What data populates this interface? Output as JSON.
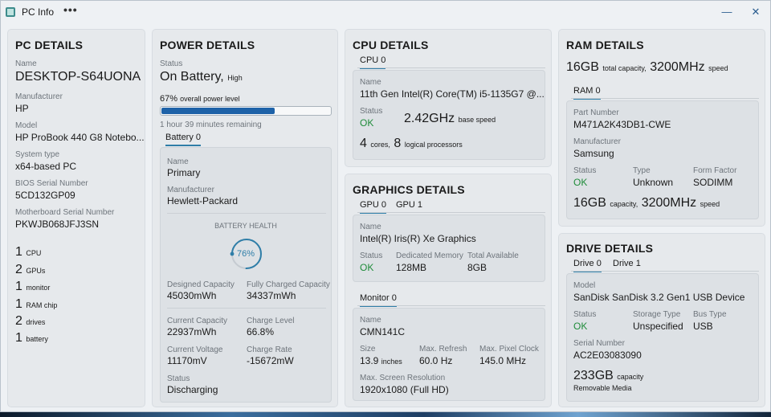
{
  "window": {
    "title": "PC Info",
    "menu_glyph": "•••",
    "minimize_glyph": "—",
    "close_glyph": "✕"
  },
  "pc": {
    "title": "PC DETAILS",
    "name_label": "Name",
    "name": "DESKTOP-S64UONA",
    "manufacturer_label": "Manufacturer",
    "manufacturer": "HP",
    "model_label": "Model",
    "model": "HP ProBook 440 G8 Notebo...",
    "system_type_label": "System type",
    "system_type": "x64-based PC",
    "bios_label": "BIOS Serial Number",
    "bios": "5CD132GP09",
    "mobo_label": "Motherboard Serial Number",
    "mobo": "PKWJB068JFJ3SN",
    "counts": [
      {
        "n": "1",
        "unit": "CPU"
      },
      {
        "n": "2",
        "unit": "GPUs"
      },
      {
        "n": "1",
        "unit": "monitor"
      },
      {
        "n": "1",
        "unit": "RAM chip"
      },
      {
        "n": "2",
        "unit": "drives"
      },
      {
        "n": "1",
        "unit": "battery"
      }
    ]
  },
  "power": {
    "title": "POWER DETAILS",
    "status_label": "Status",
    "status": "On Battery,",
    "status_level": "High",
    "level_pct": "67%",
    "level_text": "overall power level",
    "level_value": 0.67,
    "remaining": "1 hour 39 minutes remaining",
    "tab": "Battery 0",
    "name_label": "Name",
    "name": "Primary",
    "manufacturer_label": "Manufacturer",
    "manufacturer": "Hewlett-Packard",
    "health_label": "BATTERY HEALTH",
    "health_pct": "76%",
    "health_value": 0.76,
    "designed_label": "Designed Capacity",
    "designed": "45030mWh",
    "full_label": "Fully Charged Capacity",
    "full": "34337mWh",
    "current_cap_label": "Current Capacity",
    "current_cap": "22937mWh",
    "charge_level_label": "Charge Level",
    "charge_level": "66.8%",
    "voltage_label": "Current Voltage",
    "voltage": "11170mV",
    "charge_rate_label": "Charge Rate",
    "charge_rate": "-15672mW",
    "status2_label": "Status",
    "status2": "Discharging"
  },
  "cpu": {
    "title": "CPU DETAILS",
    "tab": "CPU 0",
    "name_label": "Name",
    "name": "11th Gen Intel(R) Core(TM) i5-1135G7 @...",
    "status_label": "Status",
    "status": "OK",
    "speed": "2.42GHz",
    "speed_unit": "base speed",
    "cores": "4",
    "cores_unit": "cores,",
    "logical": "8",
    "logical_unit": "logical processors"
  },
  "gpu": {
    "title": "GRAPHICS DETAILS",
    "tabs": [
      "GPU 0",
      "GPU 1"
    ],
    "name_label": "Name",
    "name": "Intel(R) Iris(R) Xe Graphics",
    "status_label": "Status",
    "status": "OK",
    "dedicated_label": "Dedicated Memory",
    "dedicated": "128MB",
    "total_label": "Total Available",
    "total": "8GB",
    "monitor_tab": "Monitor 0",
    "mon_name_label": "Name",
    "mon_name": "CMN141C",
    "size_label": "Size",
    "size": "13.9",
    "size_unit": "inches",
    "refresh_label": "Max. Refresh",
    "refresh": "60.0 Hz",
    "clock_label": "Max. Pixel Clock",
    "clock": "145.0 MHz",
    "res_label": "Max. Screen Resolution",
    "res": "1920x1080 (Full HD)"
  },
  "ram": {
    "title": "RAM DETAILS",
    "total": "16GB",
    "total_unit": "total capacity,",
    "speed": "3200MHz",
    "speed_unit": "speed",
    "tab": "RAM 0",
    "part_label": "Part Number",
    "part": "M471A2K43DB1-CWE",
    "manufacturer_label": "Manufacturer",
    "manufacturer": "Samsung",
    "status_label": "Status",
    "status": "OK",
    "type_label": "Type",
    "type": "Unknown",
    "form_label": "Form Factor",
    "form": "SODIMM",
    "cap": "16GB",
    "cap_unit": "capacity,",
    "cap_speed": "3200MHz",
    "cap_speed_unit": "speed"
  },
  "drive": {
    "title": "DRIVE DETAILS",
    "tabs": [
      "Drive 0",
      "Drive 1"
    ],
    "model_label": "Model",
    "model": "SanDisk SanDisk 3.2 Gen1 USB Device",
    "status_label": "Status",
    "status": "OK",
    "storage_label": "Storage Type",
    "storage": "Unspecified",
    "bus_label": "Bus Type",
    "bus": "USB",
    "serial_label": "Serial Number",
    "serial": "AC2E03083090",
    "cap": "233GB",
    "cap_unit": "capacity",
    "media": "Removable Media"
  },
  "colors": {
    "accent": "#2f7ea8",
    "ok": "#1f8c3a",
    "progress": "#1e62a8"
  }
}
